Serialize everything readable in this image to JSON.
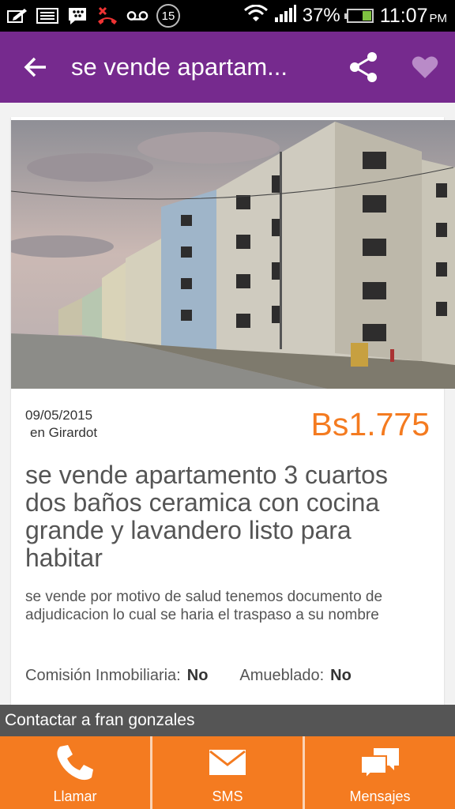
{
  "status_bar": {
    "notification_count": "15",
    "battery_percent": "37%",
    "battery_level": 0.37,
    "time": "11:07",
    "ampm": "PM",
    "icons": [
      "edit-icon",
      "image-icon",
      "blackberry-messenger-icon",
      "missed-call-icon",
      "voicemail-icon",
      "wifi-icon",
      "signal-icon",
      "battery-icon"
    ]
  },
  "app_bar": {
    "title": "se vende apartam...",
    "back_icon": "arrow-left-icon",
    "share_icon": "share-icon",
    "favorite_icon": "heart-icon"
  },
  "listing": {
    "date": "09/05/2015",
    "location": "en Girardot",
    "price": "Bs1.775",
    "title": "se vende apartamento 3 cuartos dos baños ceramica con cocina grande y lavandero listo para habitar",
    "description": "se vende por motivo de salud tenemos documento de adjudicacion lo cual se haria el traspaso a su nombre",
    "attributes": [
      {
        "label": "Comisión Inmobiliaria:",
        "value": "No"
      },
      {
        "label": "Amueblado:",
        "value": "No"
      }
    ]
  },
  "contact": {
    "label": "Contactar a fran gonzales",
    "actions": [
      {
        "label": "Llamar",
        "icon": "phone-icon"
      },
      {
        "label": "SMS",
        "icon": "envelope-icon"
      },
      {
        "label": "Mensajes",
        "icon": "chat-icon"
      }
    ]
  },
  "colors": {
    "app_bar": "#762a8e",
    "accent": "#f47b20",
    "contact_bar": "#555555",
    "heart": "#b98bc8"
  }
}
